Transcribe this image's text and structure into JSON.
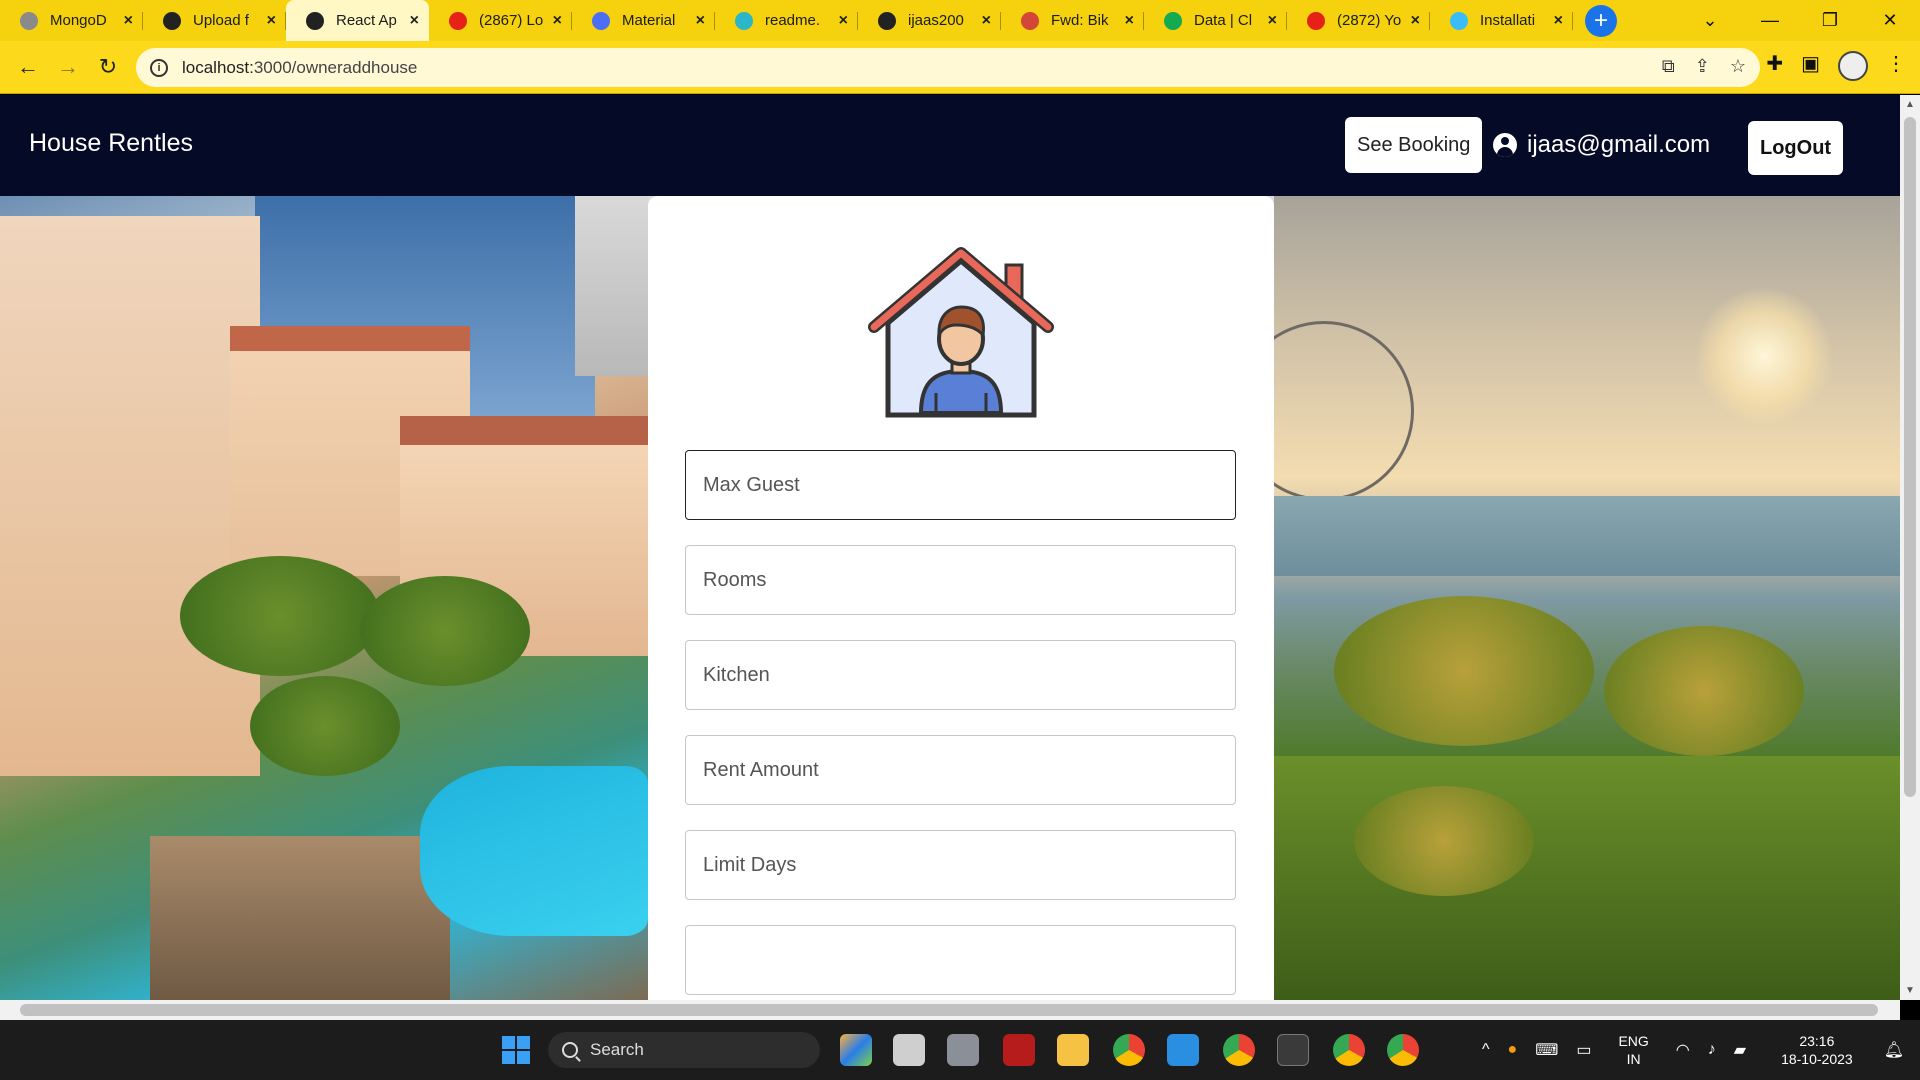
{
  "browser": {
    "tabs": [
      {
        "title": "MongoD",
        "icon": "mongodb-icon",
        "color": "#8a8a8a",
        "active": false
      },
      {
        "title": "Upload f",
        "icon": "github-icon",
        "color": "#222222",
        "active": false
      },
      {
        "title": "React Ap",
        "icon": "react-icon",
        "color": "#222222",
        "active": true
      },
      {
        "title": "(2867) Lo",
        "icon": "youtube-icon",
        "color": "#e62117",
        "active": false
      },
      {
        "title": "Material",
        "icon": "globe-icon",
        "color": "#4b6ef5",
        "active": false
      },
      {
        "title": "readme.",
        "icon": "react-icon",
        "color": "#2bb7c9",
        "active": false
      },
      {
        "title": "ijaas200",
        "icon": "github-icon",
        "color": "#222222",
        "active": false
      },
      {
        "title": "Fwd: Bik",
        "icon": "gmail-icon",
        "color": "#d44638",
        "active": false
      },
      {
        "title": "Data | Cl",
        "icon": "mongodb-leaf-icon",
        "color": "#13aa52",
        "active": false
      },
      {
        "title": "(2872) Yo",
        "icon": "youtube-icon",
        "color": "#e62117",
        "active": false
      },
      {
        "title": "Installati",
        "icon": "tailwind-icon",
        "color": "#38bdf8",
        "active": false
      }
    ],
    "url_host": "localhost:",
    "url_rest": "3000/owneraddhouse"
  },
  "navbar": {
    "brand": "House Rentles",
    "see_booking": "See Booking",
    "user_email": "ijaas@gmail.com",
    "logout": "LogOut"
  },
  "form": {
    "fields": [
      {
        "placeholder": "Max Guest",
        "focused": true
      },
      {
        "placeholder": "Rooms",
        "focused": false
      },
      {
        "placeholder": "Kitchen",
        "focused": false
      },
      {
        "placeholder": "Rent Amount",
        "focused": false
      },
      {
        "placeholder": "Limit Days",
        "focused": false
      }
    ]
  },
  "taskbar": {
    "search_label": "Search",
    "lang_line1": "ENG",
    "lang_line2": "IN",
    "time": "23:16",
    "date": "18-10-2023"
  },
  "colors": {
    "chrome_yellow": "#f5d20d",
    "navbar_bg": "#050a26",
    "card_bg": "#ffffff"
  }
}
